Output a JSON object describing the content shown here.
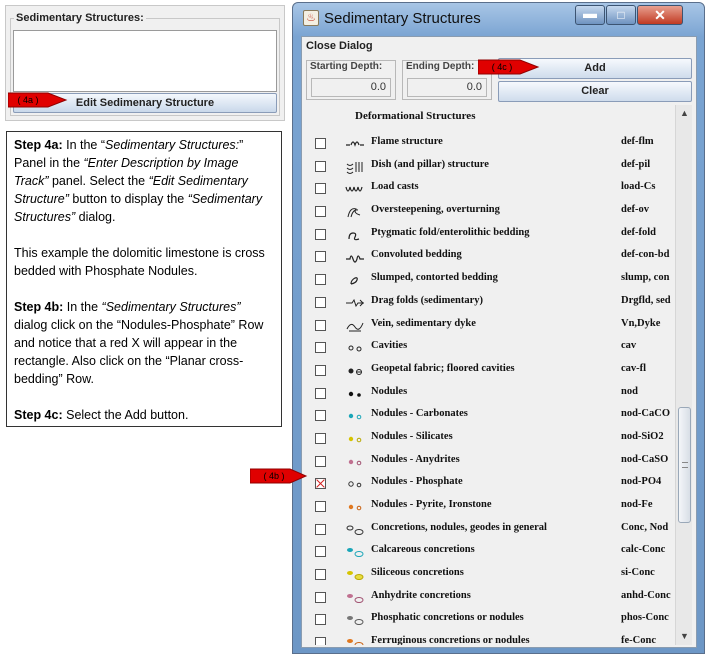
{
  "left_panel": {
    "legend": "Sedimentary Structures:",
    "edit_button": "Edit Sedimenary Structure",
    "callout_4a": "( 4a )"
  },
  "instructions": {
    "step4a_label": "Step 4a:",
    "step4a_t1": " In the “",
    "step4a_i1": "Sedimentary Structures:",
    "step4a_t2": "” Panel in the ",
    "step4a_i2": "“Enter Description by Image Track”",
    "step4a_t3": " panel.  Select the ",
    "step4a_i3": "“Edit Sedimentary Structure”",
    "step4a_t4": " button to display the ",
    "step4a_i4": "“Sedimentary Structures”",
    "step4a_t5": " dialog.",
    "example": "This example the dolomitic limestone is cross bedded with Phosphate Nodules.",
    "step4b_label": "Step 4b:",
    "step4b_t1": " In the ",
    "step4b_i1": "“Sedimentary Structures”",
    "step4b_t2": " dialog click  on the “Nodules-Phosphate” Row and notice that a red X will appear in the rectangle. Also click on the “Planar cross-bedding” Row.",
    "step4c_label": "Step 4c:",
    "step4c_t1": " Select the Add button."
  },
  "dialog": {
    "title": "Sedimentary Structures",
    "close_dialog": "Close Dialog",
    "starting_depth_label": "Starting Depth:",
    "starting_depth_value": "0.0",
    "ending_depth_label": "Ending Depth:",
    "ending_depth_value": "0.0",
    "add_button": "Add",
    "clear_button": "Clear",
    "callout_4c": "( 4c )",
    "callout_4b": "( 4b )",
    "list_header": "Deformational Structures",
    "rows": [
      {
        "label": "Flame structure",
        "code": "def-flm",
        "icon": "flame-icon",
        "checked": false
      },
      {
        "label": "Dish (and pillar) structure",
        "code": "def-pil",
        "icon": "dish-pillar-icon",
        "checked": false
      },
      {
        "label": "Load casts",
        "code": "load-Cs",
        "icon": "load-casts-icon",
        "checked": false
      },
      {
        "label": "Oversteepening, overturning",
        "code": "def-ov",
        "icon": "overturning-icon",
        "checked": false
      },
      {
        "label": "Ptygmatic fold/enterolithic bedding",
        "code": "def-fold",
        "icon": "ptygmatic-fold-icon",
        "checked": false
      },
      {
        "label": "Convoluted bedding",
        "code": "def-con-bd",
        "icon": "convoluted-icon",
        "checked": false
      },
      {
        "label": "Slumped, contorted bedding",
        "code": "slump, con",
        "icon": "slump-icon",
        "checked": false
      },
      {
        "label": "Drag folds (sedimentary)",
        "code": "Drgfld, sed",
        "icon": "drag-fold-icon",
        "checked": false
      },
      {
        "label": "Vein, sedimentary dyke",
        "code": "Vn,Dyke",
        "icon": "vein-icon",
        "checked": false
      },
      {
        "label": "Cavities",
        "code": "cav",
        "icon": "cavities-icon",
        "checked": false
      },
      {
        "label": "Geopetal fabric; floored cavities",
        "code": "cav-fl",
        "icon": "geopetal-icon",
        "checked": false
      },
      {
        "label": "Nodules",
        "code": "nod",
        "icon": "nodules-icon",
        "checked": false
      },
      {
        "label": "Nodules - Carbonates",
        "code": "nod-CaCO",
        "icon": "nodules-carbonates-icon",
        "checked": false
      },
      {
        "label": "Nodules - Silicates",
        "code": "nod-SiO2",
        "icon": "nodules-silicates-icon",
        "checked": false
      },
      {
        "label": "Nodules - Anydrites",
        "code": "nod-CaSO",
        "icon": "nodules-anhydrites-icon",
        "checked": false
      },
      {
        "label": "Nodules - Phosphate",
        "code": "nod-PO4",
        "icon": "nodules-phosphate-icon",
        "checked": true
      },
      {
        "label": "Nodules - Pyrite, Ironstone",
        "code": "nod-Fe",
        "icon": "nodules-pyrite-icon",
        "checked": false
      },
      {
        "label": "Concretions, nodules, geodes in general",
        "code": "Conc, Nod",
        "icon": "concretions-icon",
        "checked": false
      },
      {
        "label": "Calcareous concretions",
        "code": "calc-Conc",
        "icon": "calcareous-concretions-icon",
        "checked": false
      },
      {
        "label": "Siliceous concretions",
        "code": "si-Conc",
        "icon": "siliceous-concretions-icon",
        "checked": false
      },
      {
        "label": "Anhydrite concretions",
        "code": "anhd-Conc",
        "icon": "anhydrite-concretions-icon",
        "checked": false
      },
      {
        "label": "Phosphatic concretions or nodules",
        "code": "phos-Conc",
        "icon": "phosphatic-concretions-icon",
        "checked": false
      },
      {
        "label": "Ferruginous concretions or nodules",
        "code": "fe-Conc",
        "icon": "ferruginous-concretions-icon",
        "checked": false
      }
    ]
  },
  "colors": {
    "callout_red": "#e00000",
    "checkbox_x": "#d52020",
    "title_gradient_top": "#a8c6e6",
    "title_gradient_bottom": "#6d97c6"
  }
}
